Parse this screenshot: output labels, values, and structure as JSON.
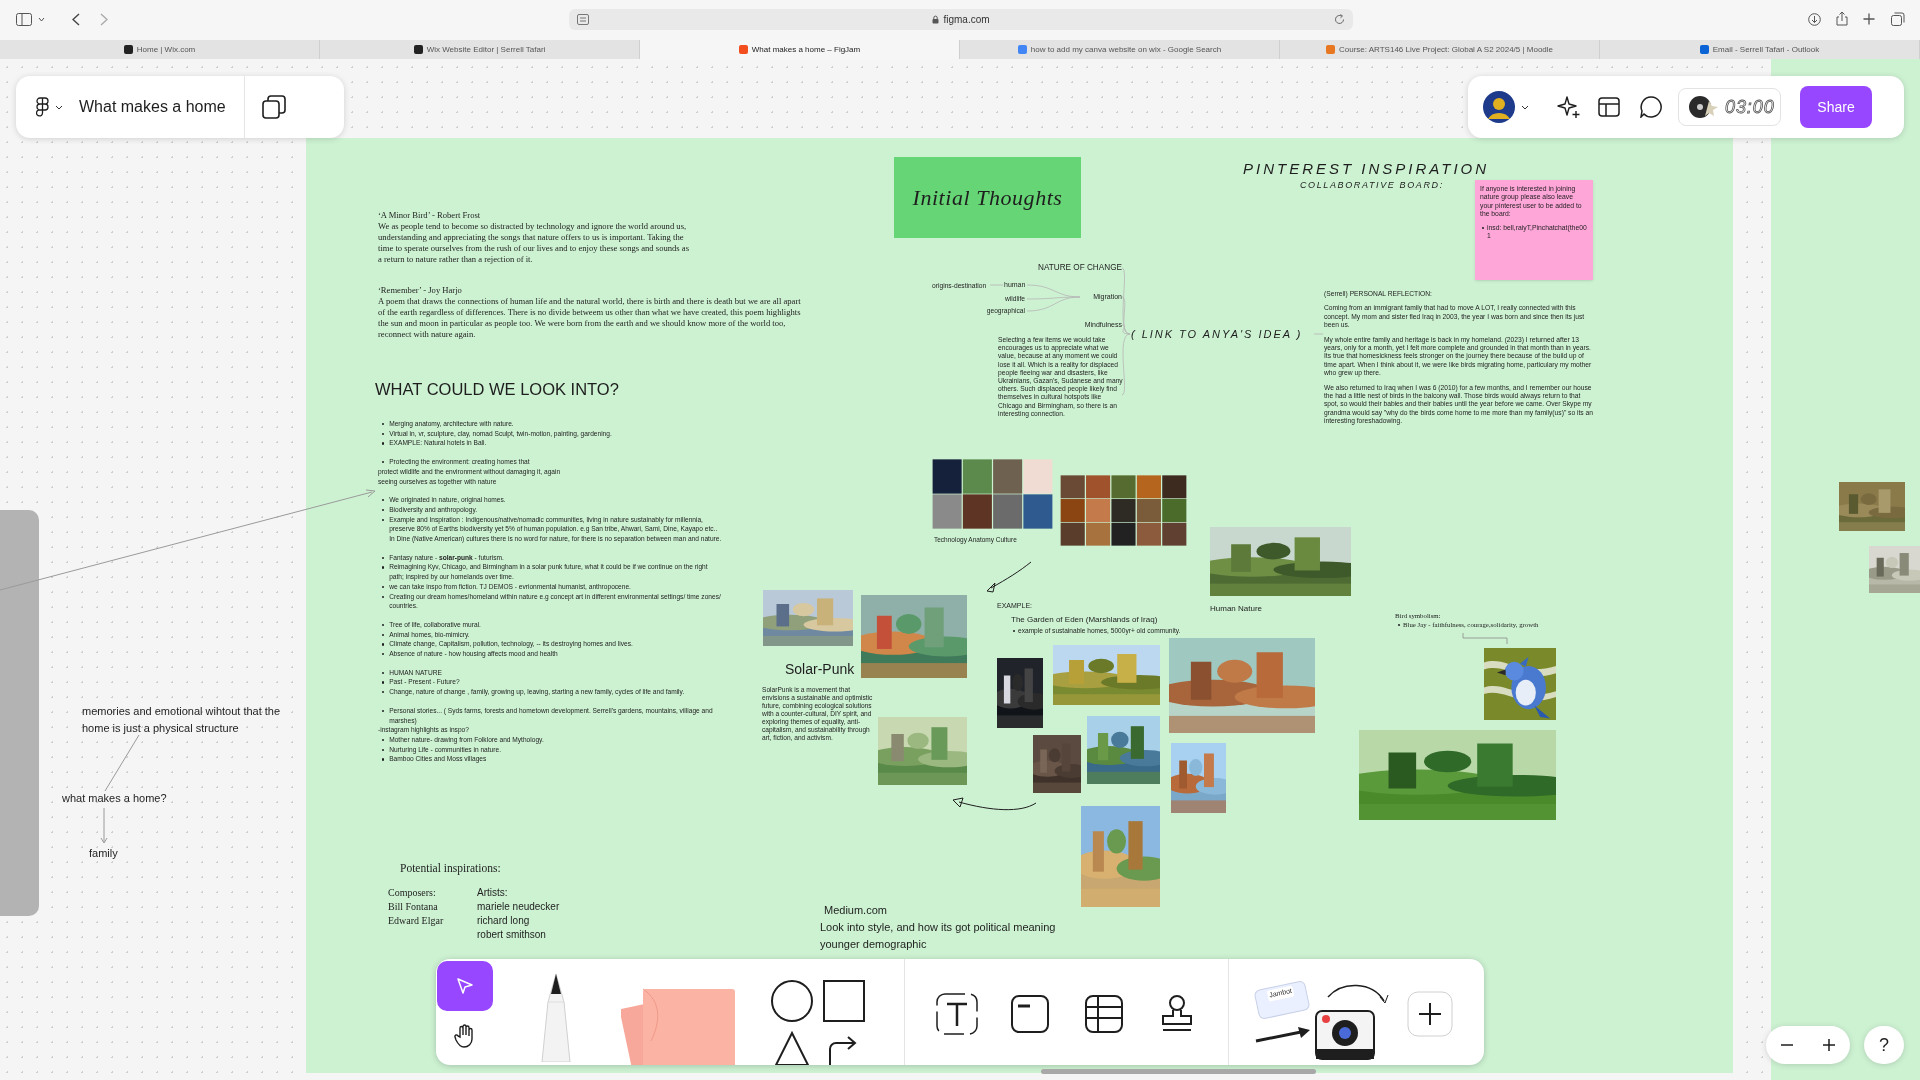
{
  "browser": {
    "address": "figma.com",
    "tabs": [
      {
        "title": "Home | Wix.com",
        "selected": false
      },
      {
        "title": "Wix Website Editor | Serrell Tafari",
        "selected": false
      },
      {
        "title": "What makes a home – FigJam",
        "selected": true
      },
      {
        "title": "how to add my canva website on wix - Google Search",
        "selected": false
      },
      {
        "title": "Course: ARTS146 Live Project: Global A S2 2024/5 | Moodle",
        "selected": false
      },
      {
        "title": "Email - Serrell Tafari - Outlook",
        "selected": false
      }
    ]
  },
  "file": {
    "title": "What makes a home"
  },
  "session": {
    "timer": "03:00",
    "share": "Share"
  },
  "poems": [
    {
      "heading": "‘A Minor Bird’ - Robert Frost",
      "body": "We as people tend to become so distracted by technology and ignore the world around us, understanding and appreciating the songs that nature offers to us is important. Taking the time to sperate ourselves from the rush of our lives and to enjoy these songs and sounds as a return to nature rather than a rejection of it."
    },
    {
      "heading": "‘Remember’ - Joy Harjo",
      "body": "A poem that draws the connections of human life and the natural world, there is birth and there is death but we are all apart of the earth regardless of differences. There is no divide betweem us other than what we have created, this poem highlights the sun and moon in particular as people too. We were born from the earth and we should know more of the world too, reconnect with nature again."
    }
  ],
  "initial_thoughts": "Initial Thoughts",
  "pinterest": {
    "title": "PINTEREST INSPIRATION",
    "subtitle": "COLLABORATIVE BOARD:",
    "sticky": "If anyone is interested in joining nature group please also leave your pinterest user to be added to the board:",
    "sticky_items": [
      "insd: bell,raiyT,Pinchatchat(the001"
    ]
  },
  "mindmap": {
    "title": "NATURE OF CHANGE",
    "root": "( LINK TO ANYA'S IDEA )",
    "migration": "Migration",
    "human": "human",
    "origins": "origins-destination",
    "wildlife": "wildlife",
    "geographical": "geographical",
    "mindfulness": "Mindfulness",
    "note": "Selecting a few items we would  take encourages us to appreciate what we value, because at any moment we could lose it all. Which is a reality for displaced people fleeing war and disasters, like Ukrainians, Gazan's, Sudanese and many others. Such displaced people likely find themselves in cultural hotspots like Chicago and Birmingham, so there is an interesting connection."
  },
  "reflection": {
    "title": "(Serrell) PERSONAL REFLECTION:",
    "paragraphs": [
      "Coming from an immigrant family that had to move A LOT, I really connected with this concept. My mom and sister fled Iraq in 2003, the year I was born and since then its just been us.",
      "My whole entire family and heritage is back in my homeland. (2023) I returned after 13 years, only for a month, yet I felt more complete and grounded in that month than in years. Its true that homesickness feels stronger on the journey there because of the build up of time apart. When I think about it, we were like birds migrating home, particulary my mother who grew up there.",
      "We also returned to Iraq when I was 6 (2010) for a few months, and I remember our house the had a little nest of birds in the balcony wall. Those birds would always return to that spot, so would their babies and their babies until the year before we came. Over Skype my grandma would say \"why do the birds come home to me more than my family(us)\" so its an interesting foreshadowing."
    ]
  },
  "look_into": {
    "heading": "WHAT COULD WE LOOK INTO?",
    "groups": [
      [
        {
          "kind": "bullet",
          "text": "Merging anatomy, architecture with nature."
        },
        {
          "kind": "bullet",
          "text": "Virtual in, vr, sculpture, clay, nomad Sculpt, twin-motion, painting, gardening."
        },
        {
          "kind": "bullet",
          "text": "EXAMPLE: Natural hotels in Bali."
        }
      ],
      [
        {
          "kind": "bullet",
          "text": "Protecting the environment: creating homes that"
        },
        {
          "kind": "plain",
          "text": "protect wildlife and the environment without damaging it, again"
        },
        {
          "kind": "plain",
          "text": "seeing ourselves as together with nature"
        }
      ],
      [
        {
          "kind": "bullet",
          "text": "We originated in nature, original homes."
        },
        {
          "kind": "bullet",
          "text": "Biodiversity and anthropology."
        },
        {
          "kind": "bullet",
          "text": "Example and Inspiration : Indigenous/native/nomadic communities, living in nature sustainably for millennia, preserve 80% of Earths biodiversity yet 5% of human population. e.g San tribe, Ahwari, Sami, Dine, Kayapo etc.. In Dine (Native American) cultures there is no word for nature, for there is no separation between man and nature."
        }
      ],
      [
        {
          "kind": "bullet",
          "text": "Fantasy nature - **solar-punk** - futurism."
        },
        {
          "kind": "bullet",
          "text": "Reimagining Kyv, Chicago, and Birmingham in a solar punk future, what it could be if we continue on the right path; inspired by our homelands over time."
        },
        {
          "kind": "bullet",
          "text": "we can take inspo from fiction. TJ DEMOS - evrionmental humanist, anthropocene."
        },
        {
          "kind": "bullet",
          "text": "Creating our dream homes/homeland within nature e.g concept art in different environmental settings/ time zones/ countries."
        }
      ],
      [
        {
          "kind": "bullet",
          "text": "Tree of life, collaborative mural."
        },
        {
          "kind": "bullet",
          "text": "Animal homes, bio-mimicry."
        },
        {
          "kind": "bullet",
          "text": "Climate change, Capitalism, pollution, technology, -- its destroying  homes and lives."
        },
        {
          "kind": "bullet",
          "text": "Absence of nature - how housing affects mood and health"
        }
      ],
      [
        {
          "kind": "bullet",
          "text": "HUMAN NATURE"
        },
        {
          "kind": "bullet",
          "text": "Past - Present - Future?"
        },
        {
          "kind": "bullet",
          "text": "Change, nature of change , family, growing up, leaving, starting a new family, cycles of life and family."
        }
      ],
      [
        {
          "kind": "bullet",
          "text": "Personal stories... ( Syds farms, forests and hometown development. Serrell's gardens, mountains, villiage and marshes)"
        },
        {
          "kind": "plain",
          "text": "-instagram highlights as inspo?"
        },
        {
          "kind": "bullet",
          "text": "Mother nature- drawing from Folklore and Mythology."
        },
        {
          "kind": "bullet",
          "text": "Nurturing Life - communities in nature."
        },
        {
          "kind": "bullet",
          "text": "Bamboo Cities and Moss villages"
        }
      ]
    ]
  },
  "images": {
    "tech_label": "Technology Anatomy Culture",
    "human_label": "Human Nature",
    "solarpunk_title": "Solar-Punk",
    "solarpunk_text": "SolarPunk is a movement that envisions a sustainable and optimistic future, combining ecological solutions with a counter-cultural, DIY spirit, and exploring themes of equality, anti-capitalism, and sustainability through art, fiction, and activism.",
    "example": "EXAMPLE:",
    "eden_title": "The Garden of Eden (Marshlands of Iraq)",
    "eden_items": [
      "example of sustainable homes, 5000yr+ old community."
    ],
    "bird_title": "Bird symbolism:",
    "bird_items": [
      "Blue Jay - faithfulness, courage,solidarity, growth"
    ]
  },
  "medium": [
    "Medium.com",
    "Look into style, and how its got political meaning",
    "younger demographic"
  ],
  "inspirations": {
    "title": "Potential inspirations:",
    "columns": [
      {
        "heading": "Composers:",
        "names": [
          "Bill Fontana",
          "Edward Elgar"
        ]
      },
      {
        "heading": "Artists:",
        "names": [
          "mariele neudecker",
          "richard long",
          "robert smithson"
        ]
      }
    ]
  },
  "canvas_notes": [
    "memories and emotional wihtout that the home is just a physical structure",
    "what makes a home?",
    "family"
  ],
  "tools": [
    {
      "kind": "select",
      "selected": true
    },
    {
      "kind": "hand",
      "selected": false
    },
    {
      "kind": "marker",
      "selected": false
    },
    {
      "kind": "sticky",
      "selected": false
    },
    {
      "kind": "shapes",
      "selected": false
    },
    {
      "kind": "text",
      "selected": false
    },
    {
      "kind": "section",
      "selected": false
    },
    {
      "kind": "table",
      "selected": false
    },
    {
      "kind": "stamp",
      "selected": false
    },
    {
      "kind": "widgets",
      "selected": false,
      "label": "Jambot"
    },
    {
      "kind": "more",
      "selected": false
    }
  ],
  "help": "?"
}
